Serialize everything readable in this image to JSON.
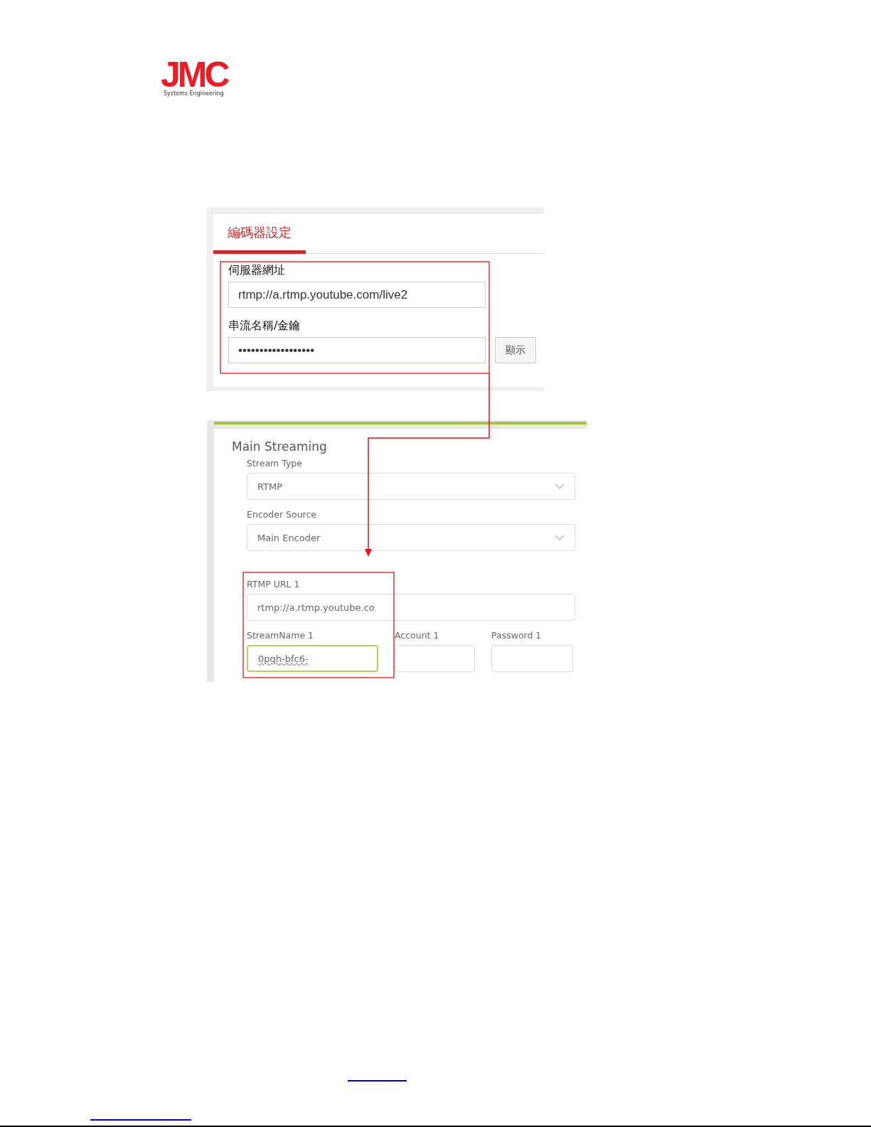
{
  "logo": {
    "mark": "JMC",
    "tagline": "Systems Engineering"
  },
  "encoder_panel": {
    "tabs": [
      {
        "label": "編碼器設定",
        "selected": true
      }
    ],
    "fields": [
      {
        "label": "伺服器網址",
        "value": "rtmp://a.rtmp.youtube.com/live2"
      },
      {
        "label": "串流名稱/金鑰",
        "value": "••••••••••••••••••"
      }
    ],
    "show_button": "顯示"
  },
  "streaming_panel": {
    "title": "Main Streaming",
    "selects": [
      {
        "label": "Stream Type",
        "value": "RTMP"
      },
      {
        "label": "Encoder Source",
        "value": "Main Encoder"
      }
    ],
    "url_field": {
      "label": "RTMP URL 1",
      "value": "rtmp://a.rtmp.youtube.co"
    },
    "fields": [
      {
        "label": "StreamName 1",
        "value": "0pqh-bfc6-",
        "focused": true
      },
      {
        "label": "Account 1",
        "focused": false
      },
      {
        "label": "Password 1",
        "focused": false
      }
    ]
  }
}
